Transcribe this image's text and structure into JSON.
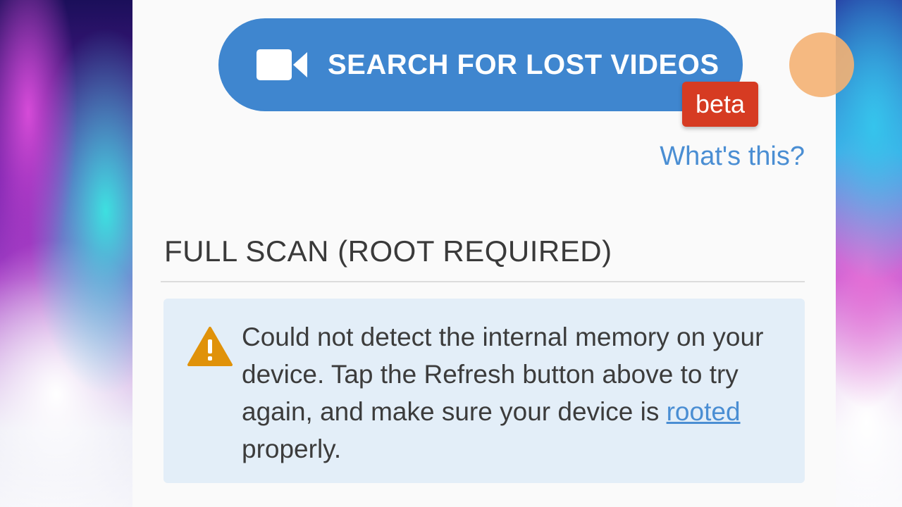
{
  "search_button": {
    "label": "SEARCH FOR LOST VIDEOS",
    "icon": "video-camera-icon",
    "color": "#3f86cf"
  },
  "beta_badge": {
    "label": "beta",
    "color": "#d63b22"
  },
  "whats_this_link": "What's this?",
  "full_scan": {
    "title": "FULL SCAN (ROOT REQUIRED)",
    "warning": {
      "icon": "warning-triangle-icon",
      "text_before": "Could not detect the internal memory on your device. Tap the Refresh button above to try again, and make sure your device is ",
      "link_text": "rooted",
      "text_after": " properly."
    }
  },
  "colors": {
    "link": "#4a8ed3",
    "warning_bg": "#e3eef8",
    "warning_icon": "#e0920a"
  }
}
